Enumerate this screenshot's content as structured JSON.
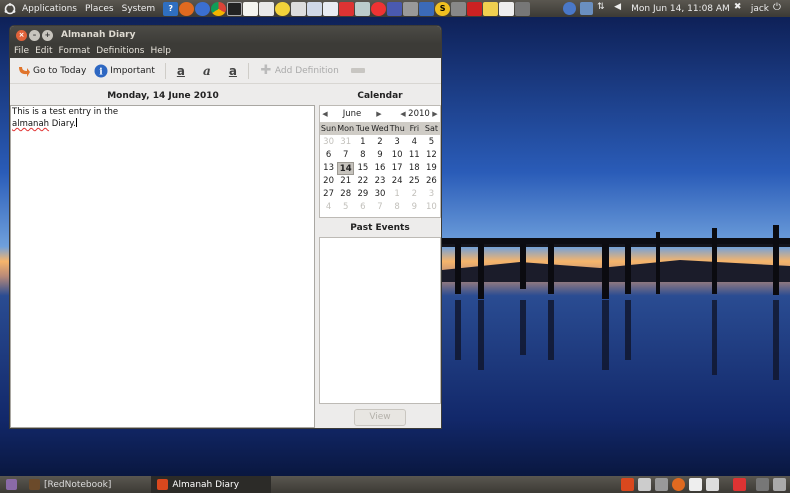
{
  "top_panel": {
    "menus": [
      "Applications",
      "Places",
      "System"
    ],
    "launcher_icons": [
      "help-icon",
      "firefox-icon",
      "thunderbird-icon",
      "chrome-icon",
      "terminal-icon",
      "text-editor-icon",
      "notes-icon",
      "smiley-icon",
      "pen-icon",
      "image-icon",
      "checklist-icon",
      "shutdown-icon",
      "monitor-icon",
      "screenshot-icon",
      "cursor-icon",
      "drive-icon",
      "stack-icon",
      "skype-icon",
      "keyboard-icon",
      "pdf-icon",
      "pencil-icon",
      "mail-icon",
      "calculator-icon"
    ],
    "clock": "Mon Jun 14, 11:08 AM",
    "user": "jack"
  },
  "window": {
    "title": "Almanah Diary",
    "menu": [
      "File",
      "Edit",
      "Format",
      "Definitions",
      "Help"
    ],
    "toolbar": {
      "go_to_today": "Go to Today",
      "important": "Important",
      "bold_glyph": "a",
      "italic_glyph": "a",
      "underline_glyph": "a",
      "add_definition": "Add Definition"
    },
    "date_header": "Monday, 14 June 2010",
    "entry": {
      "line1": "This is a test entry in the",
      "misspelt": "almanah",
      "rest": " Diary."
    },
    "calendar": {
      "title": "Calendar",
      "month": "June",
      "year": "2010",
      "weekdays": [
        "Sun",
        "Mon",
        "Tue",
        "Wed",
        "Thu",
        "Fri",
        "Sat"
      ],
      "weeks": [
        [
          "30",
          "31",
          "1",
          "2",
          "3",
          "4",
          "5"
        ],
        [
          "6",
          "7",
          "8",
          "9",
          "10",
          "11",
          "12"
        ],
        [
          "13",
          "14",
          "15",
          "16",
          "17",
          "18",
          "19"
        ],
        [
          "20",
          "21",
          "22",
          "23",
          "24",
          "25",
          "26"
        ],
        [
          "27",
          "28",
          "29",
          "30",
          "1",
          "2",
          "3"
        ],
        [
          "4",
          "5",
          "6",
          "7",
          "8",
          "9",
          "10"
        ]
      ],
      "selected_day": "14"
    },
    "past_events_title": "Past Events",
    "view_button": "View"
  },
  "bottom_panel": {
    "tasks": [
      "[RedNotebook]",
      "Almanah Diary"
    ]
  }
}
